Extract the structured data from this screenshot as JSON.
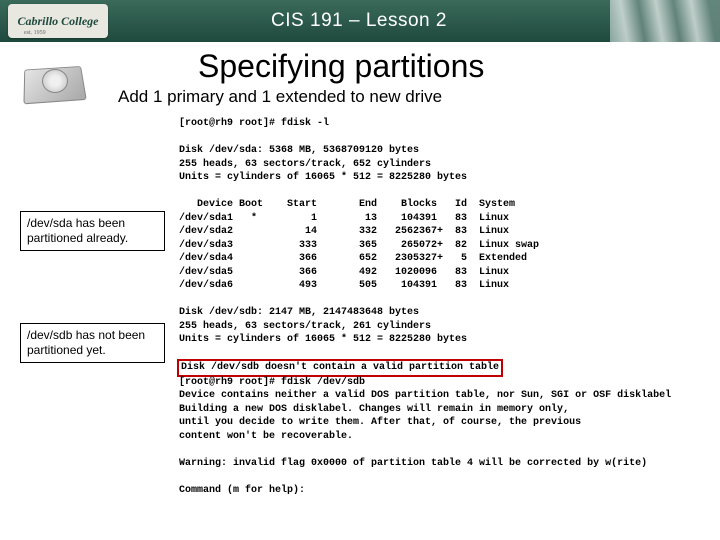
{
  "banner": {
    "logo_text": "Cabrillo College",
    "logo_sub": "est. 1959",
    "title": "CIS 191 – Lesson 2"
  },
  "heading": "Specifying partitions",
  "subheading": "Add 1 primary and 1 extended to new drive",
  "callout_sda": "/dev/sda has been partitioned already.",
  "callout_sdb": "/dev/sdb has not been partitioned yet.",
  "term": {
    "prompt1": "[root@rh9 root]# fdisk -l",
    "disk_sda_header": "Disk /dev/sda: 5368 MB, 5368709120 bytes\n255 heads, 63 sectors/track, 652 cylinders\nUnits = cylinders of 16065 * 512 = 8225280 bytes",
    "part_table": "   Device Boot    Start       End    Blocks   Id  System\n/dev/sda1   *         1        13    104391   83  Linux\n/dev/sda2            14       332   2562367+  83  Linux\n/dev/sda3           333       365    265072+  82  Linux swap\n/dev/sda4           366       652   2305327+   5  Extended\n/dev/sda5           366       492   1020096   83  Linux\n/dev/sda6           493       505    104391   83  Linux",
    "disk_sdb_header": "Disk /dev/sdb: 2147 MB, 2147483648 bytes\n255 heads, 63 sectors/track, 261 cylinders\nUnits = cylinders of 16065 * 512 = 8225280 bytes",
    "sdb_error": "Disk /dev/sdb doesn't contain a valid partition table",
    "prompt2": "[root@rh9 root]# fdisk /dev/sdb",
    "fdisk_msg": "Device contains neither a valid DOS partition table, nor Sun, SGI or OSF disklabel\nBuilding a new DOS disklabel. Changes will remain in memory only,\nuntil you decide to write them. After that, of course, the previous\ncontent won't be recoverable.",
    "warning": "Warning: invalid flag 0x0000 of partition table 4 will be corrected by w(rite)",
    "cmd_prompt": "Command (m for help):"
  }
}
